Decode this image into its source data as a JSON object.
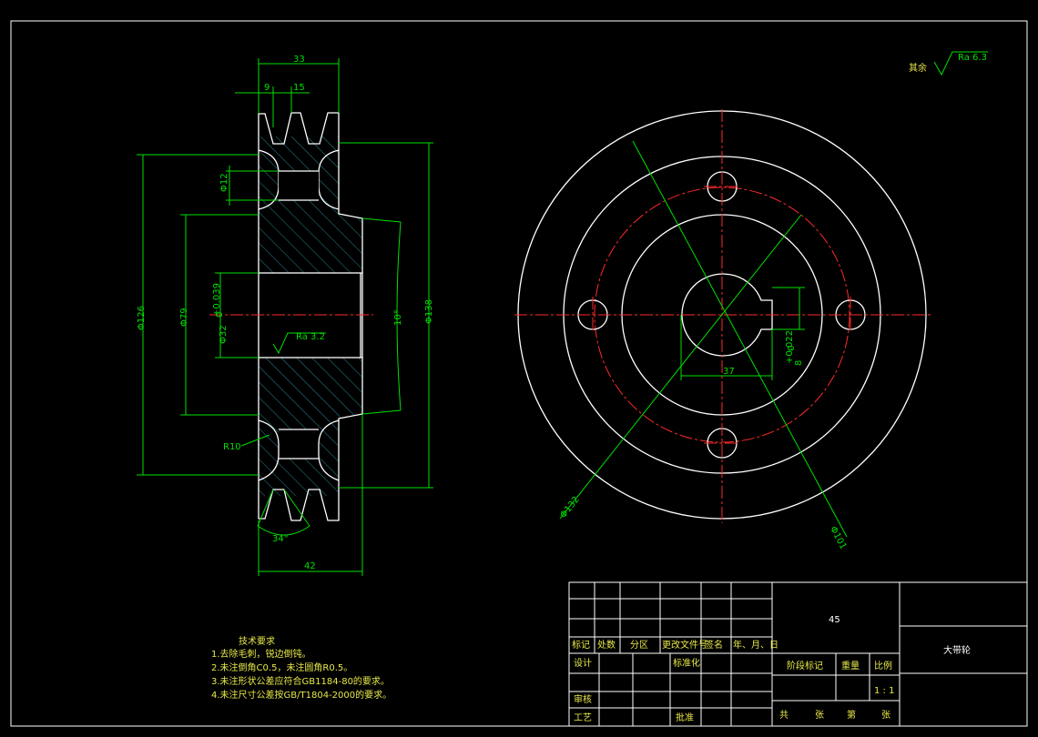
{
  "roughness_note": {
    "prefix": "其余",
    "value": "Ra 6.3"
  },
  "section_view": {
    "dims": {
      "width_33": "33",
      "groove_9": "9",
      "groove_15": "15",
      "hole_12": "Φ12",
      "dia_126": "Φ126",
      "dia_79": "Φ79",
      "bore": "Φ32",
      "bore_tol_up": "+0.039",
      "bore_tol_low": "0",
      "roughness_bore": "Ra 3.2",
      "angle_10": "10°",
      "dia_138": "Φ138",
      "radius_10": "R10",
      "angle_34": "34°",
      "width_42": "42"
    }
  },
  "front_view": {
    "dims": {
      "keyway_8": "8",
      "keyway_tol_up": "+0.022",
      "keyway_tol_low": "0",
      "keyway_37": "37",
      "dia_132": "Φ132",
      "dia_101": "Φ101"
    }
  },
  "tech_requirements": {
    "title": "技术要求",
    "items": [
      "1.去除毛刺，锐边倒钝。",
      "2.未注倒角C0.5，未注圆角R0.5。",
      "3.未注形状公差应符合GB1184-80的要求。",
      "4.未注尺寸公差按GB/T1804-2000的要求。"
    ]
  },
  "title_block": {
    "material": "45",
    "part_name": "大带轮",
    "rev_headers": [
      "标记",
      "处数",
      "分区",
      "更改文件号",
      "签名",
      "年、月、日"
    ],
    "design": "设计",
    "standardization": "标准化",
    "check": "审核",
    "process": "工艺",
    "approve": "批准",
    "stage_mark": "阶段标记",
    "weight": "重量",
    "scale": "比例",
    "scale_value": "1 : 1",
    "sheet_total": "共",
    "sheet_unit": "张",
    "sheet_no": "第",
    "sheet_unit2": "张"
  }
}
